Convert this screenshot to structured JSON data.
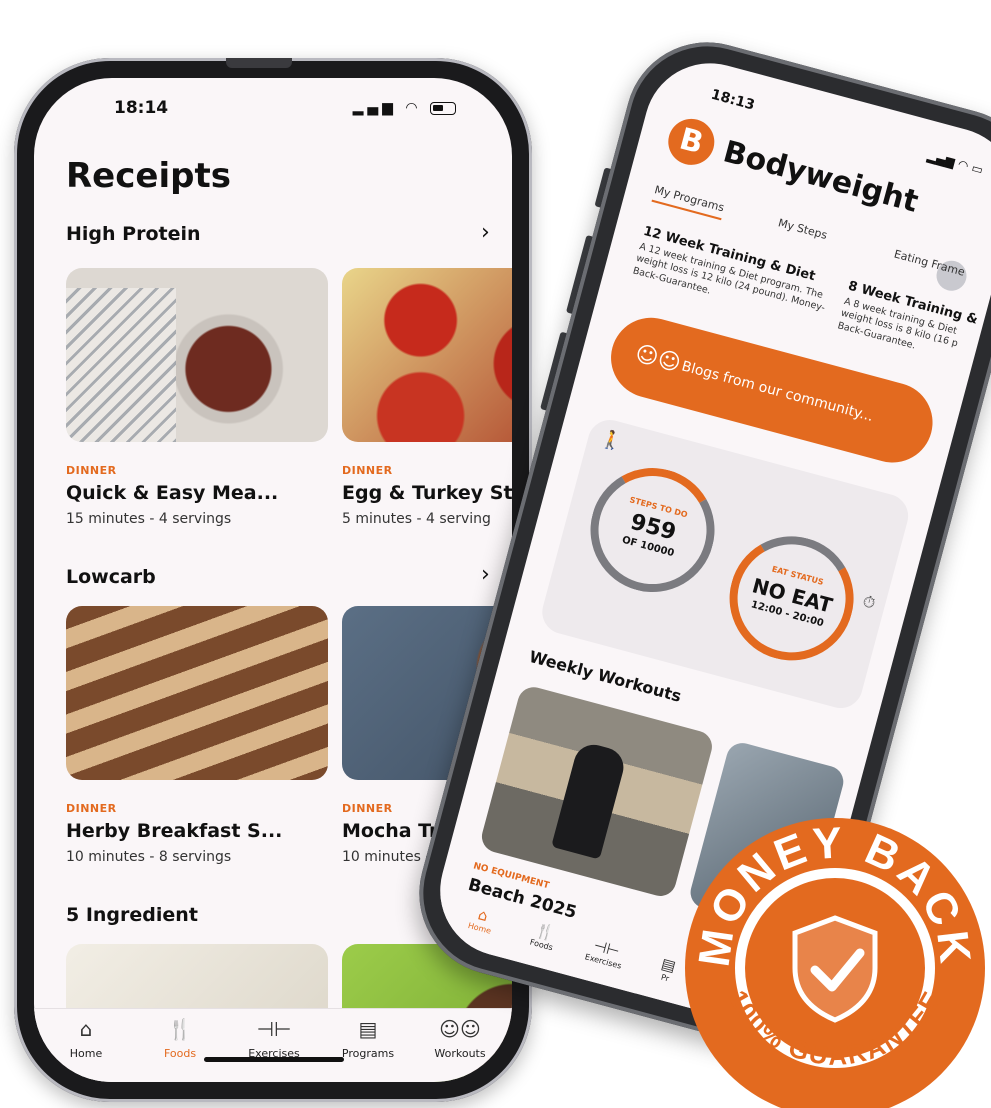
{
  "left_phone": {
    "status": {
      "time": "18:14"
    },
    "title": "Receipts",
    "sections": [
      {
        "title": "High Protein",
        "cards": [
          {
            "category": "DINNER",
            "title": "Quick & Easy Mea...",
            "meta": "15 minutes - 4 servings"
          },
          {
            "category": "DINNER",
            "title": "Egg & Turkey St",
            "meta": "5 minutes - 4 serving"
          }
        ]
      },
      {
        "title": "Lowcarb",
        "cards": [
          {
            "category": "DINNER",
            "title": "Herby Breakfast S...",
            "meta": "10 minutes - 8 servings"
          },
          {
            "category": "DINNER",
            "title": "Mocha Tru",
            "meta": "10 minutes - 10"
          }
        ]
      },
      {
        "title": "5 Ingredient"
      }
    ],
    "tabbar": [
      {
        "label": "Home",
        "icon": "home-icon"
      },
      {
        "label": "Foods",
        "icon": "fork-knife-icon",
        "active": true
      },
      {
        "label": "Exercises",
        "icon": "dumbbell-icon"
      },
      {
        "label": "Programs",
        "icon": "calendar-icon"
      },
      {
        "label": "Workouts",
        "icon": "group-icon"
      }
    ]
  },
  "right_phone": {
    "status": {
      "time": "18:13"
    },
    "brand": "Bodyweight",
    "tabs": [
      "My Programs",
      "My Steps",
      "Eating Frame"
    ],
    "programs": [
      {
        "title": "12 Week Training & Diet",
        "desc": "A 12 week training & Diet program. The weight loss is 12 kilo (24 pound). Money-Back-Guarantee."
      },
      {
        "title": "8 Week Training &",
        "desc": "A 8 week training & Diet weight loss is 8 kilo (16 p Back-Guarantee."
      }
    ],
    "blog_button": "Blogs from our community...",
    "steps": {
      "label": "STEPS TO DO",
      "value": "959",
      "of": "OF 10000"
    },
    "eat": {
      "label": "EAT STATUS",
      "value": "NO EAT",
      "window": "12:00 - 20:00"
    },
    "weekly_title": "Weekly Workouts",
    "workout": {
      "category": "NO EQUIPMENT",
      "title": "Beach 2025"
    },
    "tabbar": [
      {
        "label": "Home",
        "active": true
      },
      {
        "label": "Foods"
      },
      {
        "label": "Exercises"
      },
      {
        "label": "Pr"
      }
    ]
  },
  "badge": {
    "top_text": "MONEY BACK",
    "bottom_text": "100% GUARANTEE"
  },
  "colors": {
    "accent": "#e36a1f",
    "screen_bg": "#faf6f8"
  }
}
